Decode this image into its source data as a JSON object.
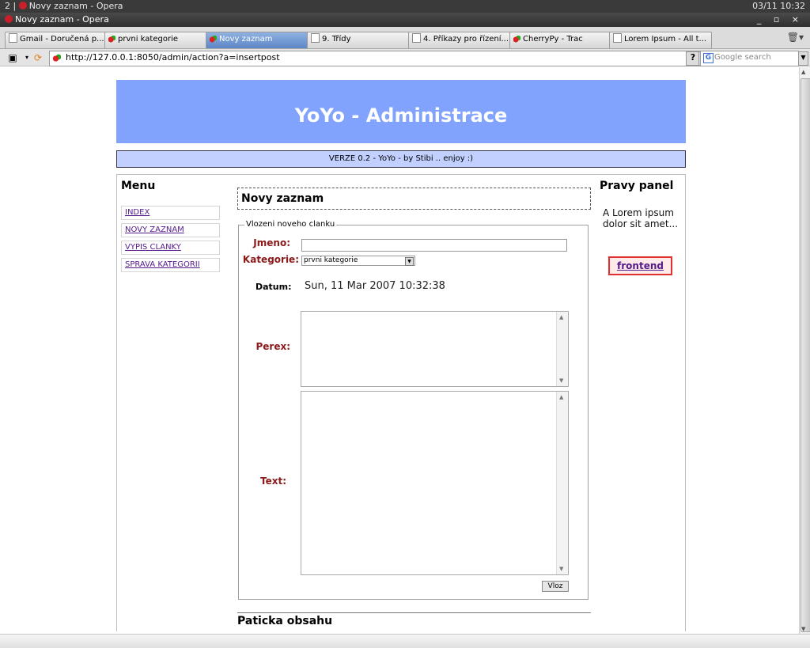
{
  "system_bar": {
    "workspace": "2 |",
    "title": "Novy zaznam - Opera",
    "clock": "03/11   10:32"
  },
  "window": {
    "title": "Novy zaznam - Opera",
    "controls": "_ ▫ ×"
  },
  "tabs": [
    {
      "label": "Gmail - Doručená p..."
    },
    {
      "label": "prvni kategorie"
    },
    {
      "label": "Novy zaznam"
    },
    {
      "label": "9. Třídy"
    },
    {
      "label": "4. Příkazy pro řízení..."
    },
    {
      "label": "CherryPy - Trac"
    },
    {
      "label": "Lorem Ipsum - All t..."
    }
  ],
  "address": {
    "url": "http://127.0.0.1:8050/admin/action?a=insertpost",
    "help": "?",
    "search_placeholder": "Google search",
    "search_logo": "G"
  },
  "page": {
    "banner": "YoYo - Administrace",
    "version": "VERZE 0.2 - YoYo - by Stibi .. enjoy :)",
    "menu": {
      "title": "Menu",
      "items": [
        {
          "label": "INDEX"
        },
        {
          "label": "NOVY ZAZNAM"
        },
        {
          "label": "VYPIS CLANKY"
        },
        {
          "label": "SPRAVA KATEGORII"
        }
      ]
    },
    "content": {
      "title": "Novy zaznam",
      "form": {
        "legend": "Vlozeni noveho clanku",
        "name_label": "Jmeno:",
        "name_value": "",
        "category_label": "Kategorie:",
        "category_value": "prvni kategorie",
        "date_label": "Datum:",
        "date_value": "Sun, 11 Mar 2007 10:32:38",
        "perex_label": "Perex:",
        "text_label": "Text:",
        "submit_label": "Vloz"
      },
      "footer": "Paticka obsahu"
    },
    "right_panel": {
      "title": "Pravy panel",
      "text": "A Lorem ipsum dolor sit amet...",
      "link": "frontend"
    }
  }
}
